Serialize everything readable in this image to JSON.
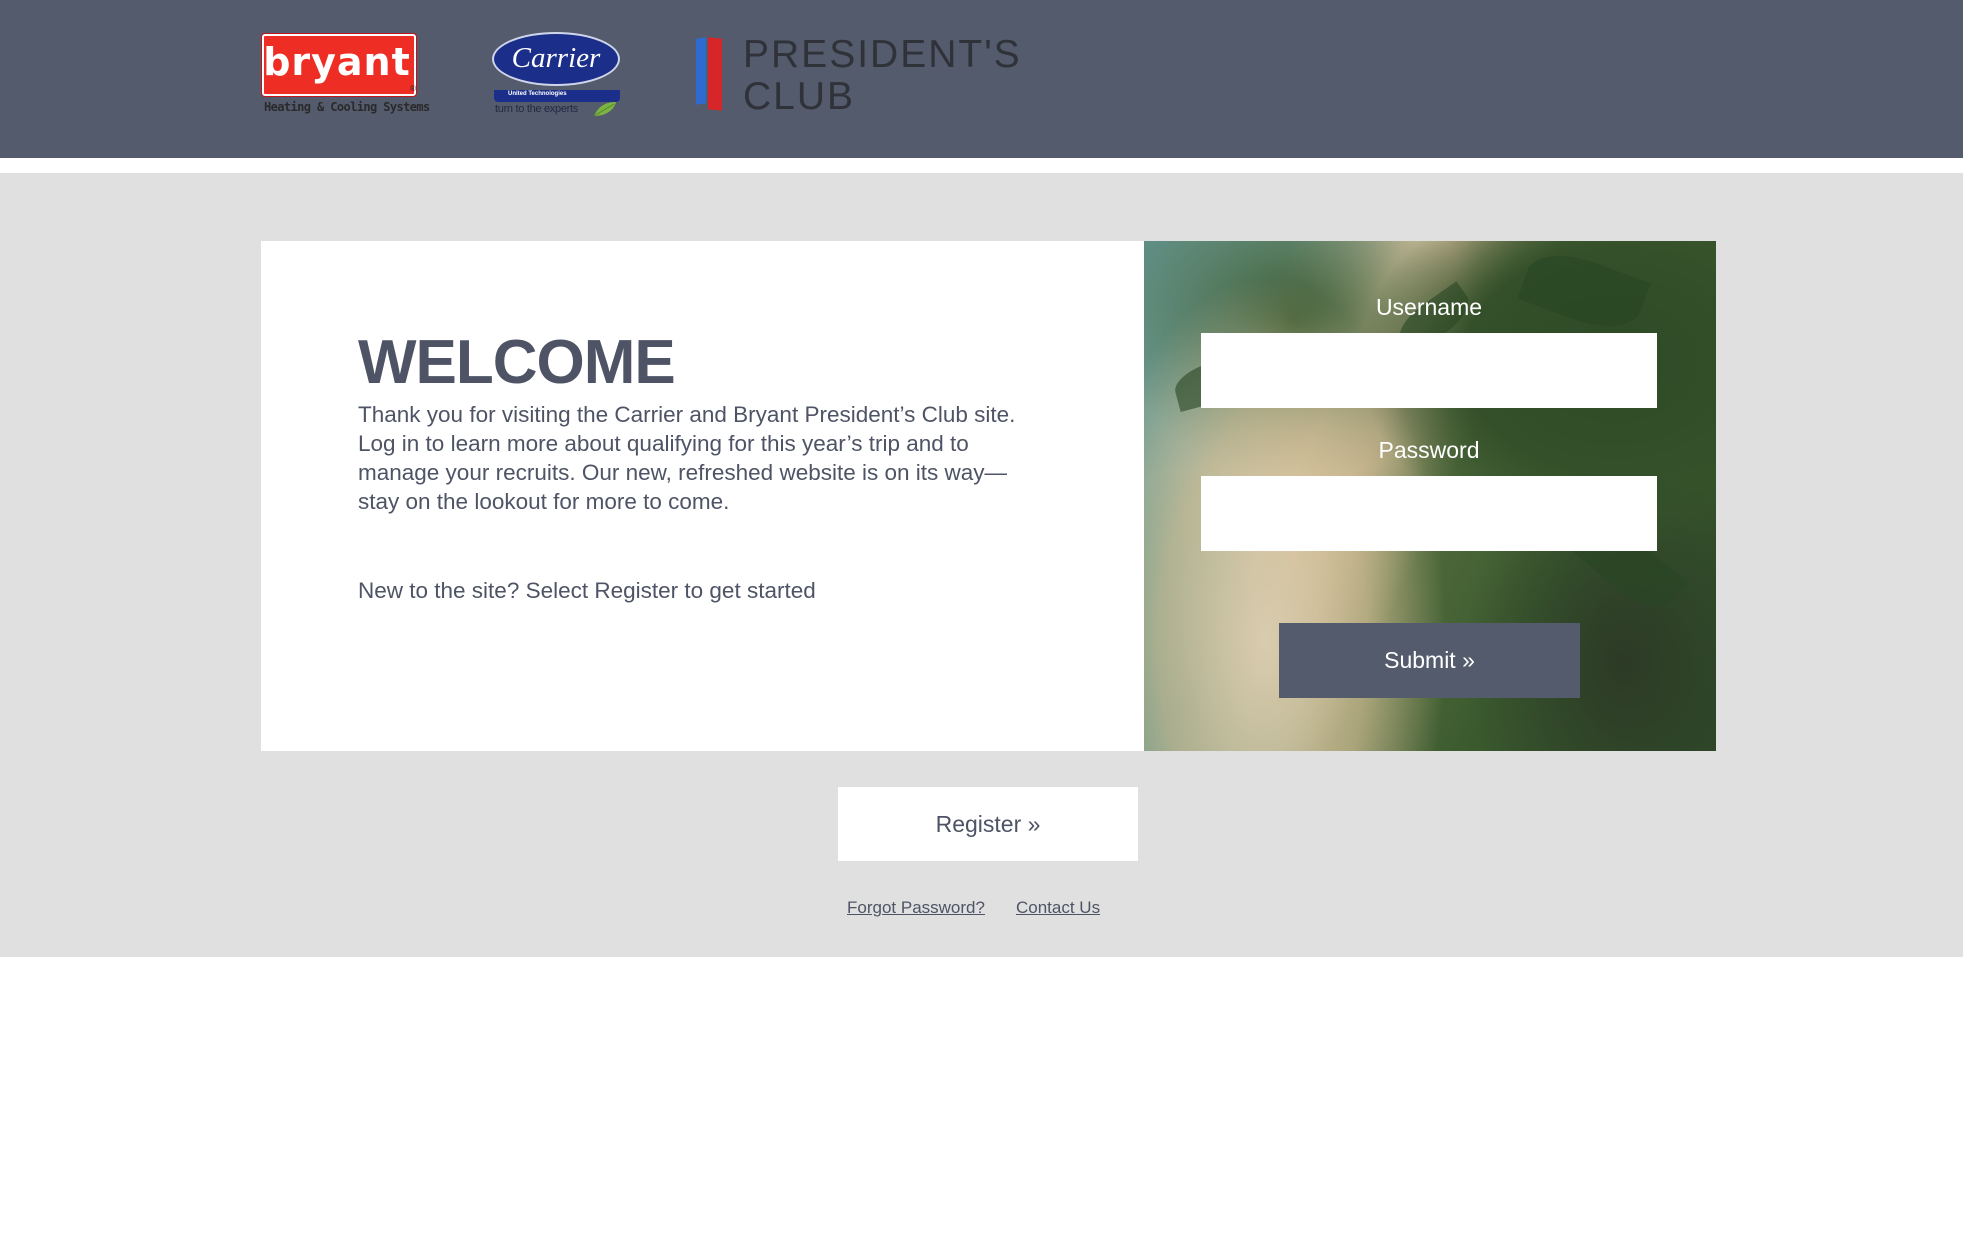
{
  "header": {
    "bryant_logo": {
      "word": "bryant",
      "tagline": "Heating & Cooling Systems",
      "reg": "®"
    },
    "carrier_logo": {
      "word": "Carrier",
      "tagline": "turn to the experts",
      "utc": "United Technologies"
    },
    "presidents_club_logo": {
      "line1": "PRESIDENT'S",
      "line2": "CLUB"
    }
  },
  "welcome": {
    "title": "WELCOME",
    "body": "Thank you for visiting the Carrier and Bryant President’s Club site. Log in to learn more about qualifying for this year’s trip and to manage your recruits. Our new, refreshed website is on its way—stay on the lookout for more to come.",
    "new_to_site": "New to the site? Select Register to get started"
  },
  "login": {
    "username_label": "Username",
    "username_value": "",
    "password_label": "Password",
    "password_value": "",
    "submit_label": "Submit »"
  },
  "register_label": "Register »",
  "footer": {
    "forgot_password": "Forgot Password?",
    "contact_us": "Contact Us"
  },
  "colors": {
    "header_bg": "#545b6d",
    "band_bg": "#e0e0e0",
    "text": "#4e5465",
    "button_bg": "#545b6d"
  }
}
